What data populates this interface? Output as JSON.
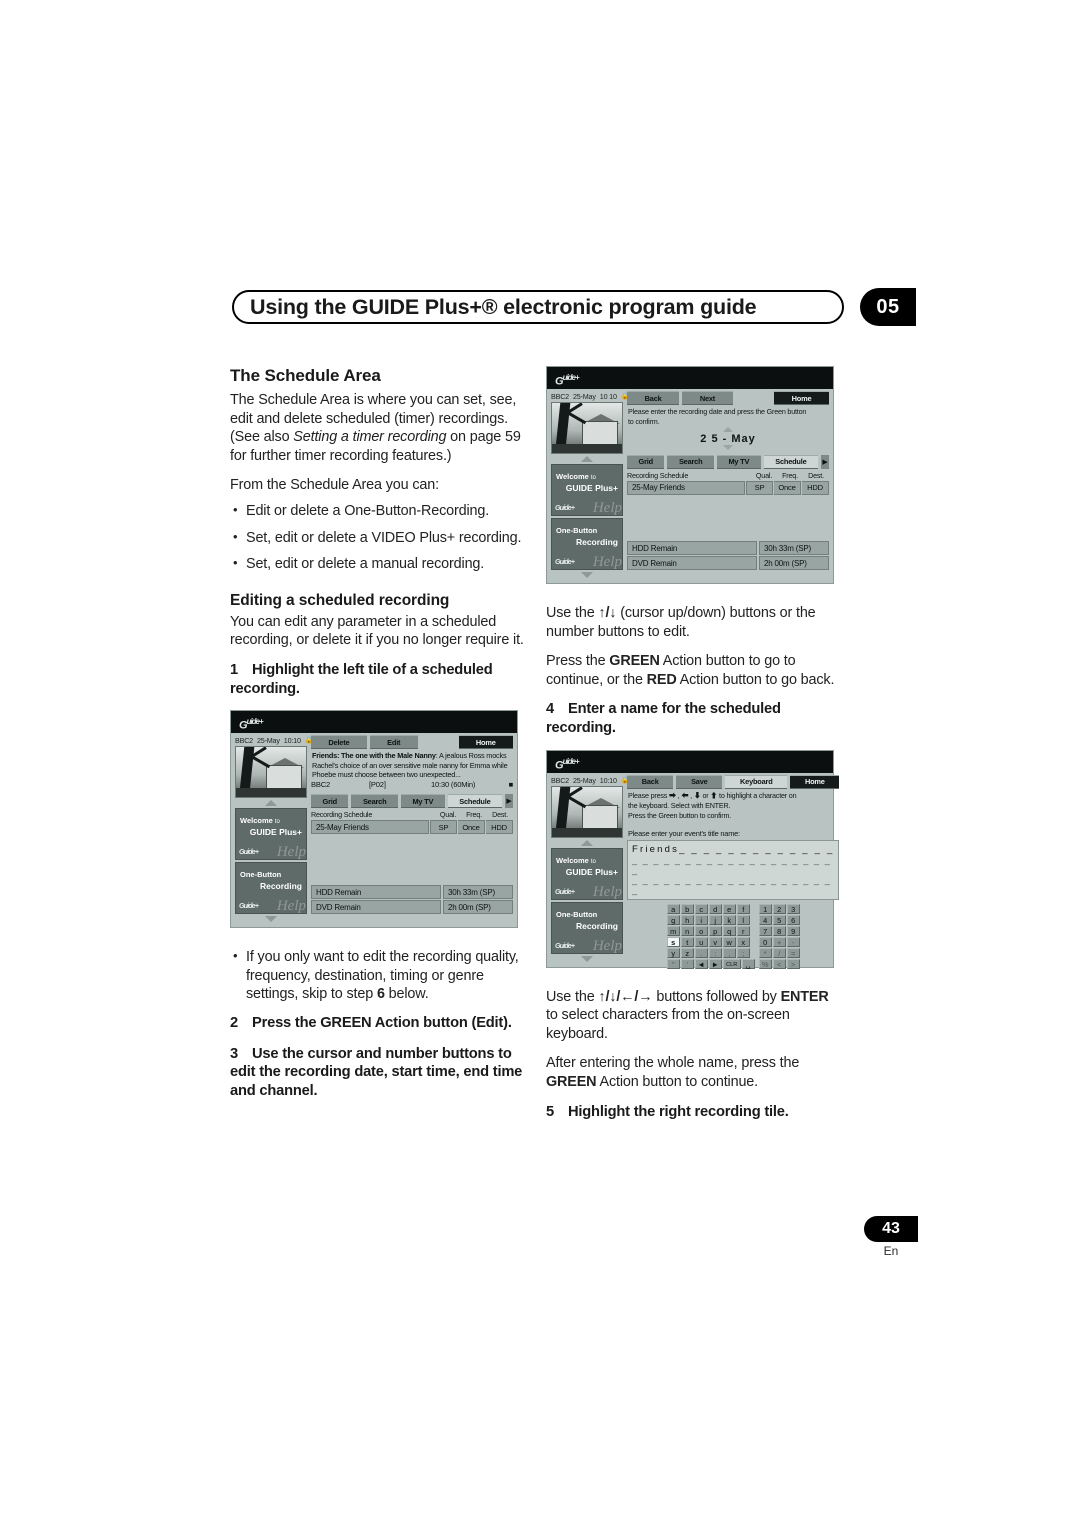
{
  "header": {
    "title": "Using the GUIDE Plus+® electronic program guide",
    "chapter": "05"
  },
  "footer": {
    "page_number": "43",
    "language": "En"
  },
  "left_column": {
    "section_title": "The Schedule Area",
    "intro_p1_a": "The Schedule Area is where you can set, see, edit and delete scheduled (timer) recordings. (See also ",
    "intro_p1_italic": "Setting a timer recording",
    "intro_p1_b": " on page 59 for further timer recording features.)",
    "intro_p2": "From the Schedule Area you can:",
    "bullets": [
      "Edit or delete a One-Button-Recording.",
      "Set, edit or delete a VIDEO Plus+ recording.",
      "Set, edit or delete a manual recording."
    ],
    "subsection_title": "Editing a scheduled recording",
    "subsection_body": "You can edit any parameter in a scheduled recording, or delete it if you no longer require it.",
    "step1_num": "1",
    "step1_text": "Highlight the left tile of a scheduled recording.",
    "note_bullet_a": "If you only want to edit the recording quality, frequency, destination, timing or genre settings, skip to step ",
    "note_bullet_bold": "6",
    "note_bullet_b": " below.",
    "step2_num": "2",
    "step2_text": "Press the GREEN Action button (Edit).",
    "step3_num": "3",
    "step3_text": "Use the cursor and number buttons to edit the recording date, start time, end time and channel."
  },
  "right_column": {
    "p1_a": "Use the ",
    "p1_icons": "↑/↓",
    "p1_b": " (cursor up/down) buttons or the number buttons to edit.",
    "p2_a": "Press the ",
    "p2_green": "GREEN",
    "p2_b": " Action button to go to continue, or the ",
    "p2_red": "RED",
    "p2_c": " Action button to go back.",
    "step4_num": "4",
    "step4_text": "Enter a name for the scheduled recording.",
    "p3_a": "Use the ",
    "p3_icons": "↑/↓/←/→",
    "p3_b": " buttons followed by ",
    "p3_enter": "ENTER",
    "p3_c": " to select characters from the on-screen keyboard.",
    "p4_a": "After entering the whole name, press the ",
    "p4_green": "GREEN",
    "p4_b": " Action button to continue.",
    "step5_num": "5",
    "step5_text": "Highlight the right recording tile."
  },
  "screenshot_date_edit": {
    "logo": "GUIDE Plus+",
    "channel": "BBC2",
    "date": "25-May",
    "time": "10 10",
    "lock_icon": "lock-icon",
    "buttons": {
      "back": "Back",
      "next": "Next",
      "home": "Home"
    },
    "message_line1": "Please enter the recording date and press the Green button",
    "message_line2": "to confirm.",
    "date_value": "2 5  -  May",
    "nav_tabs": [
      "Grid",
      "Search",
      "My TV",
      "Schedule"
    ],
    "nav_active": "Schedule",
    "schedule_header": {
      "title": "Recording Schedule",
      "qual": "Qual.",
      "freq": "Freq.",
      "dest": "Dest."
    },
    "schedule_rows": [
      {
        "name": "25-May  Friends",
        "qual": "SP",
        "freq": "Once",
        "dest": "HDD"
      }
    ],
    "remain": [
      {
        "label": "HDD Remain",
        "value": "30h 33m (SP)"
      },
      {
        "label": "DVD Remain",
        "value": "2h 00m (SP)"
      }
    ],
    "side_tiles": [
      {
        "line1": "Welcome",
        "small": "to",
        "line2": "GUIDE Plus+",
        "watermark": "Help"
      },
      {
        "line1": "One-Button",
        "small": "",
        "line2": "Recording",
        "watermark": "Help"
      }
    ]
  },
  "screenshot_schedule_list": {
    "logo": "GUIDE Plus+",
    "channel": "BBC2",
    "date": "25-May",
    "time": "10:10",
    "lock_icon": "lock-icon",
    "buttons": {
      "delete": "Delete",
      "edit": "Edit",
      "home": "Home"
    },
    "program_title": "Friends: The one with the Male Nanny",
    "program_desc": ": A jealous Ross mocks Rachel's choice of an over sensitive male nanny for Emma while Phoebe must choose between two unexpected...",
    "meta": {
      "channel": "BBC2",
      "videoplus": "[P02]",
      "time": "10:30 (60Min)"
    },
    "nav_tabs": [
      "Grid",
      "Search",
      "My TV",
      "Schedule"
    ],
    "nav_active": "Schedule",
    "schedule_header": {
      "title": "Recording Schedule",
      "qual": "Qual.",
      "freq": "Freq.",
      "dest": "Dest."
    },
    "schedule_rows": [
      {
        "name": "25-May  Friends",
        "qual": "SP",
        "freq": "Once",
        "dest": "HDD"
      }
    ],
    "remain": [
      {
        "label": "HDD Remain",
        "value": "30h 33m (SP)"
      },
      {
        "label": "DVD Remain",
        "value": "2h 00m (SP)"
      }
    ],
    "side_tiles": [
      {
        "line1": "Welcome",
        "small": "to",
        "line2": "GUIDE Plus+",
        "watermark": "Help"
      },
      {
        "line1": "One-Button",
        "small": "",
        "line2": "Recording",
        "watermark": "Help"
      }
    ]
  },
  "screenshot_keyboard": {
    "logo": "GUIDE Plus+",
    "channel": "BBC2",
    "date": "25-May",
    "time": "10:10",
    "lock_icon": "lock-icon",
    "buttons": {
      "back": "Back",
      "save": "Save",
      "keyboard": "Keyboard",
      "home": "Home"
    },
    "instruction_line1": "Please press ⮕ , ⬅ , ⬇ or ⬆ to highlight a character on",
    "instruction_line2": "the keyboard. Select with ENTER.",
    "instruction_line3": "Press the Green button to confirm.",
    "prompt": "Please enter your event's title name:",
    "entered_name": "Friends",
    "keyboard_letters": [
      [
        "a",
        "b",
        "c",
        "d",
        "e",
        "f"
      ],
      [
        "g",
        "h",
        "i",
        "j",
        "k",
        "l"
      ],
      [
        "m",
        "n",
        "o",
        "p",
        "q",
        "r"
      ],
      [
        "s",
        "t",
        "u",
        "v",
        "w",
        "x"
      ],
      [
        "y",
        "z",
        ".",
        ":",
        ",",
        ";"
      ],
      [
        "\"",
        "'",
        "◄",
        "►",
        "CLR",
        "␣"
      ]
    ],
    "keyboard_highlighted": "s",
    "keyboard_numbers": [
      [
        "1",
        "2",
        "3"
      ],
      [
        "4",
        "5",
        "6"
      ],
      [
        "7",
        "8",
        "9"
      ],
      [
        "0",
        "+",
        "-"
      ],
      [
        "*",
        "/",
        "="
      ],
      [
        "%",
        "<",
        ">"
      ]
    ],
    "side_tiles": [
      {
        "line1": "Welcome",
        "small": "to",
        "line2": "GUIDE Plus+",
        "watermark": "Help"
      },
      {
        "line1": "One-Button",
        "small": "",
        "line2": "Recording",
        "watermark": "Help"
      }
    ]
  }
}
